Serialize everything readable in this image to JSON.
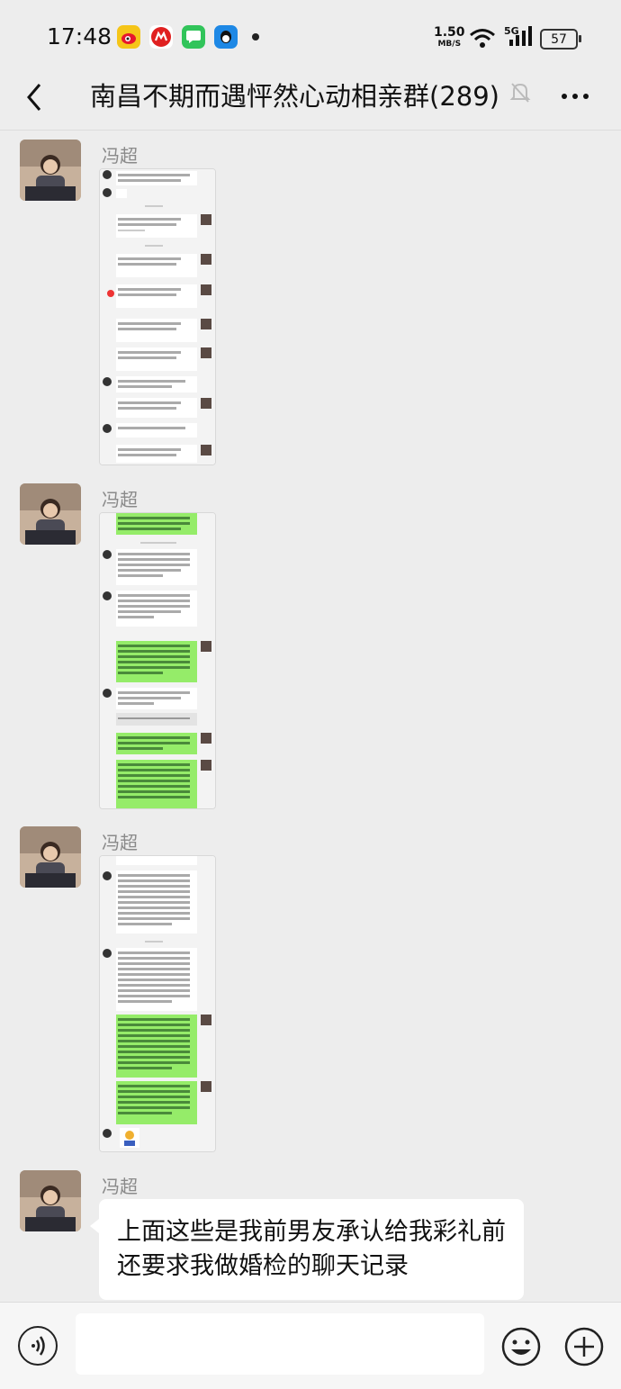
{
  "status_bar": {
    "time": "17:48",
    "net_speed_value": "1.50",
    "net_speed_unit": "MB/S",
    "signal_label": "5G",
    "battery": "57",
    "app_icons": [
      "weibo-icon",
      "meituan-icon",
      "messages-icon",
      "qq-icon"
    ]
  },
  "header": {
    "title": "南昌不期而遇怦然心动相亲群(289)"
  },
  "messages": [
    {
      "sender": "冯超",
      "type": "image"
    },
    {
      "sender": "冯超",
      "type": "image"
    },
    {
      "sender": "冯超",
      "type": "image"
    },
    {
      "sender": "冯超",
      "type": "text",
      "text": "上面这些是我前男友承认给我彩礼前还要求我做婚检的聊天记录"
    }
  ],
  "colors": {
    "background": "#ededed",
    "bubble": "#ffffff",
    "chat_green": "#95ec69"
  }
}
